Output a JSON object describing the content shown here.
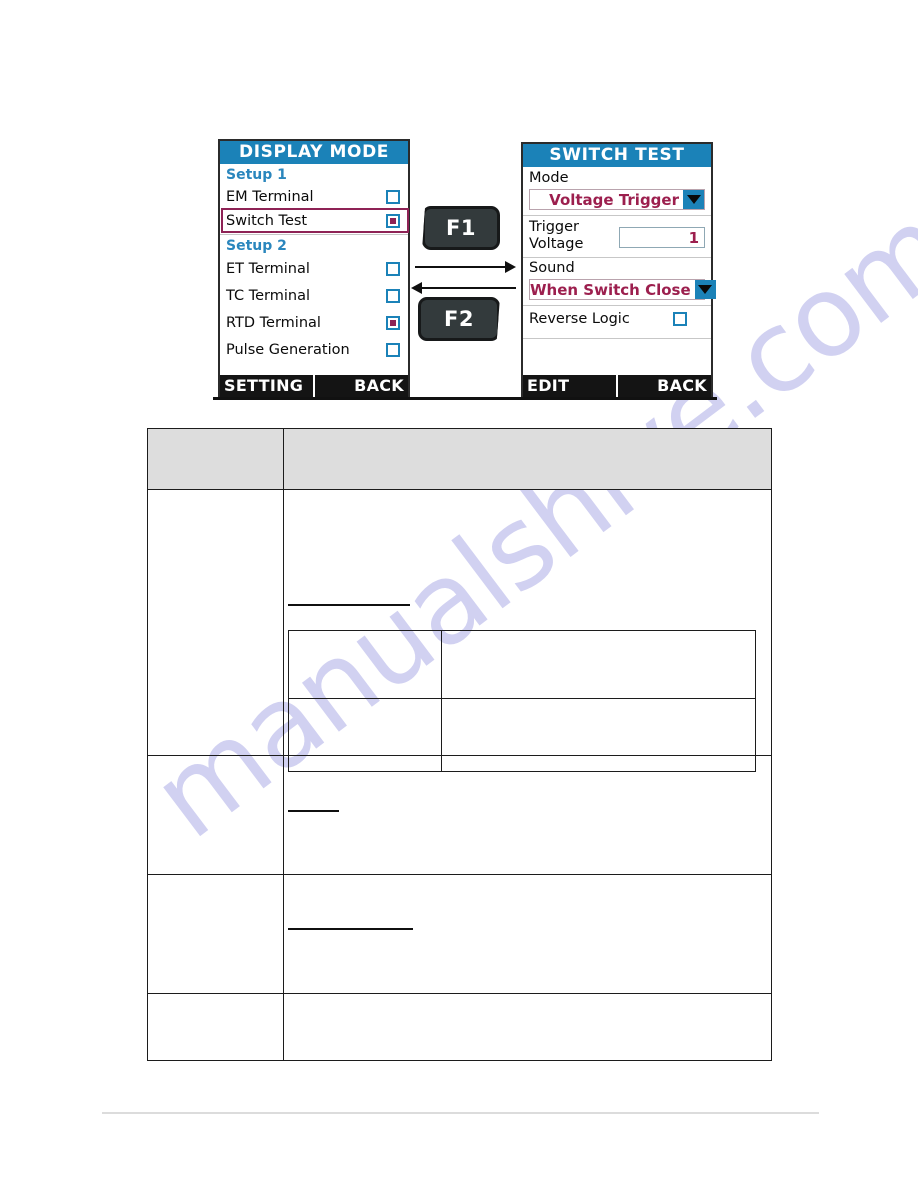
{
  "device_diagram": {
    "left_screen": {
      "title": "DISPLAY MODE",
      "groups": [
        {
          "label": "Setup 1"
        },
        {
          "label": "Setup 2"
        }
      ],
      "items": [
        {
          "label": "EM Terminal",
          "checked": false,
          "highlighted": false
        },
        {
          "label": "Switch Test",
          "checked": true,
          "highlighted": true
        },
        {
          "label": "ET Terminal",
          "checked": false,
          "highlighted": false
        },
        {
          "label": "TC Terminal",
          "checked": false,
          "highlighted": false
        },
        {
          "label": "RTD Terminal",
          "checked": true,
          "highlighted": false
        },
        {
          "label": "Pulse Generation",
          "checked": false,
          "highlighted": false
        }
      ],
      "softkeys": {
        "left": "SETTING",
        "right": "BACK"
      }
    },
    "right_screen": {
      "title": "SWITCH TEST",
      "fields": {
        "mode_label": "Mode",
        "mode_value": "Voltage Trigger",
        "trigger_voltage_label_line1": "Trigger",
        "trigger_voltage_label_line2": "Voltage",
        "trigger_voltage_value": "1",
        "sound_label": "Sound",
        "sound_value": "When Switch Close",
        "reverse_logic_label": "Reverse Logic",
        "reverse_logic_checked": false
      },
      "softkeys": {
        "left": "EDIT",
        "right": "BACK"
      }
    },
    "function_keys": [
      {
        "label": "F1"
      },
      {
        "label": "F2"
      }
    ],
    "transition_arrows": [
      {
        "direction": "right"
      },
      {
        "direction": "left"
      }
    ]
  },
  "spec_table": {
    "header_row": {
      "col1": "",
      "col2": ""
    },
    "rows": [
      {
        "col1": "",
        "col2": ""
      },
      {
        "col1": "",
        "col2": ""
      },
      {
        "col1": "",
        "col2": ""
      },
      {
        "col1": "",
        "col2": ""
      }
    ],
    "inner_table": {
      "rows": [
        {
          "col1": "",
          "col2": ""
        },
        {
          "col1": "",
          "col2": ""
        }
      ]
    }
  },
  "watermark": {
    "text": "manualshive.com"
  },
  "colors": {
    "lcd_header_blue": "#1b82b8",
    "lcd_group_text": "#2a86bd",
    "lcd_value_maroon": "#9c1f4e",
    "highlight_maroon": "#8e2255",
    "softkey_bar": "#141414",
    "table_header_gray": "#dddddd",
    "watermark_lavender": "#c9c9ef"
  }
}
